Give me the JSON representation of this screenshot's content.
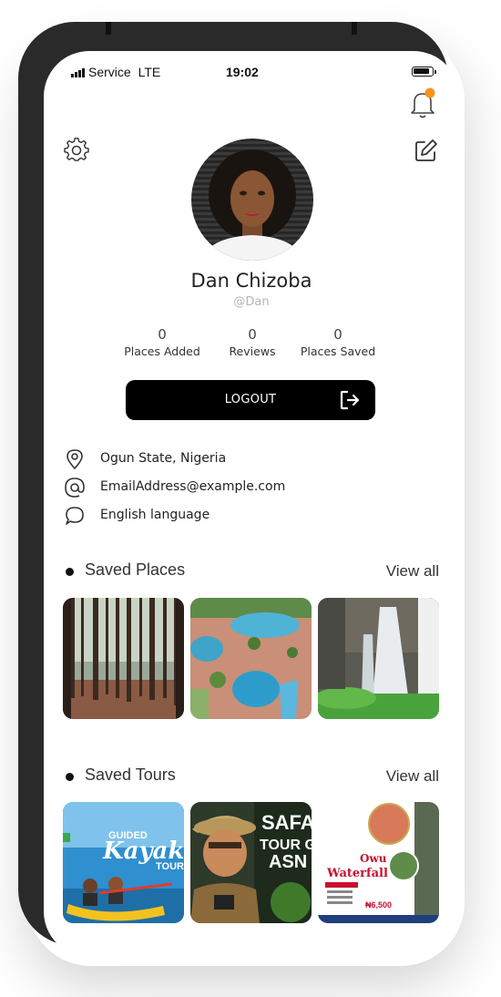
{
  "status_bar": {
    "carrier": "Service",
    "network": "LTE",
    "time": "19:02"
  },
  "profile": {
    "name": "Dan Chizoba",
    "handle": "@Dan",
    "stats": [
      {
        "value": "0",
        "label": "Places Added"
      },
      {
        "value": "0",
        "label": "Reviews"
      },
      {
        "value": "0",
        "label": "Places Saved"
      }
    ],
    "logout_label": "LOGOUT",
    "info": {
      "location": "Ogun State, Nigeria",
      "email": "EmailAddress@example.com",
      "language": "English language"
    }
  },
  "saved_places": {
    "title": "Saved Places",
    "view_all": "View all",
    "items": [
      {
        "name": "forest"
      },
      {
        "name": "resort-pools"
      },
      {
        "name": "waterfall"
      }
    ]
  },
  "saved_tours": {
    "title": "Saved Tours",
    "view_all": "View all",
    "items": [
      {
        "poster_text": [
          "GUIDED",
          "Kayak",
          "TOUR"
        ]
      },
      {
        "poster_text": [
          "SAFA",
          "TOUR G",
          "ASN"
        ]
      },
      {
        "poster_text": [
          "Owu",
          "Waterfall",
          "₦6,500"
        ]
      }
    ]
  },
  "colors": {
    "accent_notification": "#f7941d",
    "button_bg": "#000000",
    "muted_text": "#b5b5b5"
  },
  "icons": [
    "bell-icon",
    "gear-icon",
    "edit-icon",
    "logout-arrow-icon",
    "location-pin-icon",
    "at-icon",
    "speech-bubble-icon"
  ]
}
